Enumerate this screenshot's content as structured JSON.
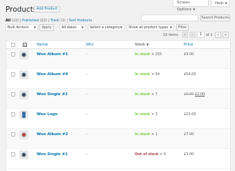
{
  "header": {
    "screen_options": "Screen Options",
    "help": "Help",
    "title": "Products",
    "add_product": "Add Product"
  },
  "filters_links": {
    "all": "All",
    "all_count": "(22)",
    "published": "Published",
    "published_count": "(22)",
    "trash": "Trash",
    "trash_count": "(1)",
    "sort": "Sort Products",
    "sep": "|"
  },
  "search": {
    "button": "Search Products",
    "value": ""
  },
  "toolbar": {
    "bulk_actions": "Bulk Actions",
    "apply": "Apply",
    "dates": "All dates",
    "category": "Select a category",
    "product_type": "Show all product types",
    "filter": "Filter"
  },
  "pagination": {
    "items": "22 items",
    "first": "«",
    "prev": "‹",
    "current": "1",
    "of": "of 2",
    "next": "›",
    "last": "»"
  },
  "columns": {
    "name": "Name",
    "sku": "SKU",
    "stock": "Stock",
    "sort_indicator": "▼",
    "price": "Price"
  },
  "rows": [
    {
      "name": "Woo Album #1",
      "sku": "–",
      "stock_status": "In stock",
      "stock_qty": "× 255",
      "price": "£9.00",
      "price_old": "",
      "thumb": "album"
    },
    {
      "name": "Woo Album #4",
      "sku": "–",
      "stock_status": "In stock",
      "stock_qty": "× 54",
      "price": "£54.00",
      "price_old": "",
      "thumb": "album"
    },
    {
      "name": "Woo Single #2",
      "sku": "–",
      "stock_status": "In stock",
      "stock_qty": "× 7",
      "price": "£2.00",
      "price_old": "£3.00",
      "thumb": "album"
    },
    {
      "name": "Woo Logo",
      "sku": "–",
      "stock_status": "In stock",
      "stock_qty": "× 3",
      "price": "£15.00",
      "price_old": "",
      "thumb": "logo"
    },
    {
      "name": "Woo Album #2",
      "sku": "–",
      "stock_status": "In stock",
      "stock_qty": "× 1",
      "price": "£7.00",
      "price_old": "",
      "thumb": "album-red"
    },
    {
      "name": "Woo Single #1",
      "sku": "–",
      "stock_status": "Out of stock",
      "stock_qty": "× 0",
      "price": "£3.00",
      "price_old": "",
      "thumb": "album"
    }
  ],
  "colors": {
    "link": "#0073aa",
    "in_stock": "#7ad03a",
    "out_of_stock": "#a44"
  }
}
